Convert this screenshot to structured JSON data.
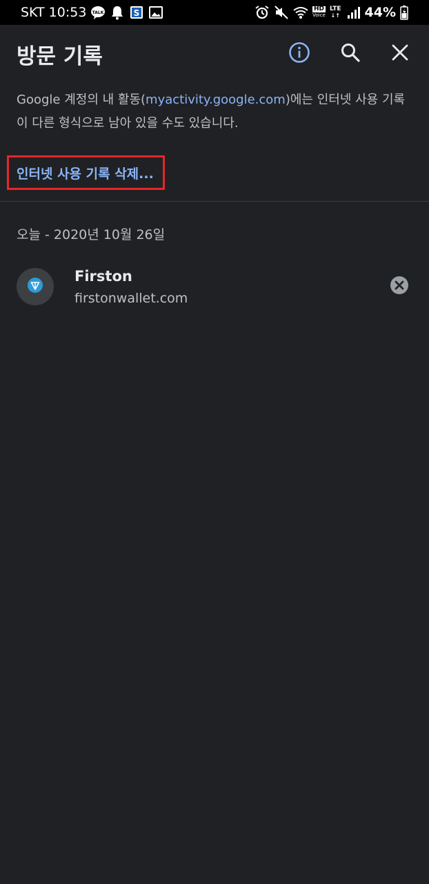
{
  "status_bar": {
    "carrier": "SKT",
    "time": "10:53",
    "left_icons": [
      "talk-icon",
      "bell-icon",
      "s-app-icon",
      "image-icon"
    ],
    "right_icons": [
      "alarm-icon",
      "mute-icon",
      "wifi-icon",
      "hd-voice-icon",
      "lte-icon",
      "signal-icon",
      "battery-icon"
    ],
    "hd_label": "HD",
    "voice_label": "Voice",
    "lte_label": "LTE",
    "battery_percent": "44%"
  },
  "toolbar": {
    "title": "방문 기록",
    "info_icon": "info-icon",
    "search_icon": "search-icon",
    "close_icon": "close-icon",
    "accent_color": "#8ab4f8"
  },
  "description": {
    "prefix": "Google 계정의 내 활동(",
    "link": "myactivity.google.com",
    "suffix": ")에는 인터넷 사용 기록이 다른 형식으로 남아 있을 수도 있습니다."
  },
  "clear_history": {
    "label": "인터넷 사용 기록 삭제...",
    "highlight_color": "#e8262a"
  },
  "history": {
    "date_header": "오늘 - 2020년 10월 26일",
    "items": [
      {
        "title": "Firston",
        "url": "firstonwallet.com",
        "favicon": "firston-logo-icon",
        "remove_icon": "remove-circle-icon"
      }
    ]
  }
}
